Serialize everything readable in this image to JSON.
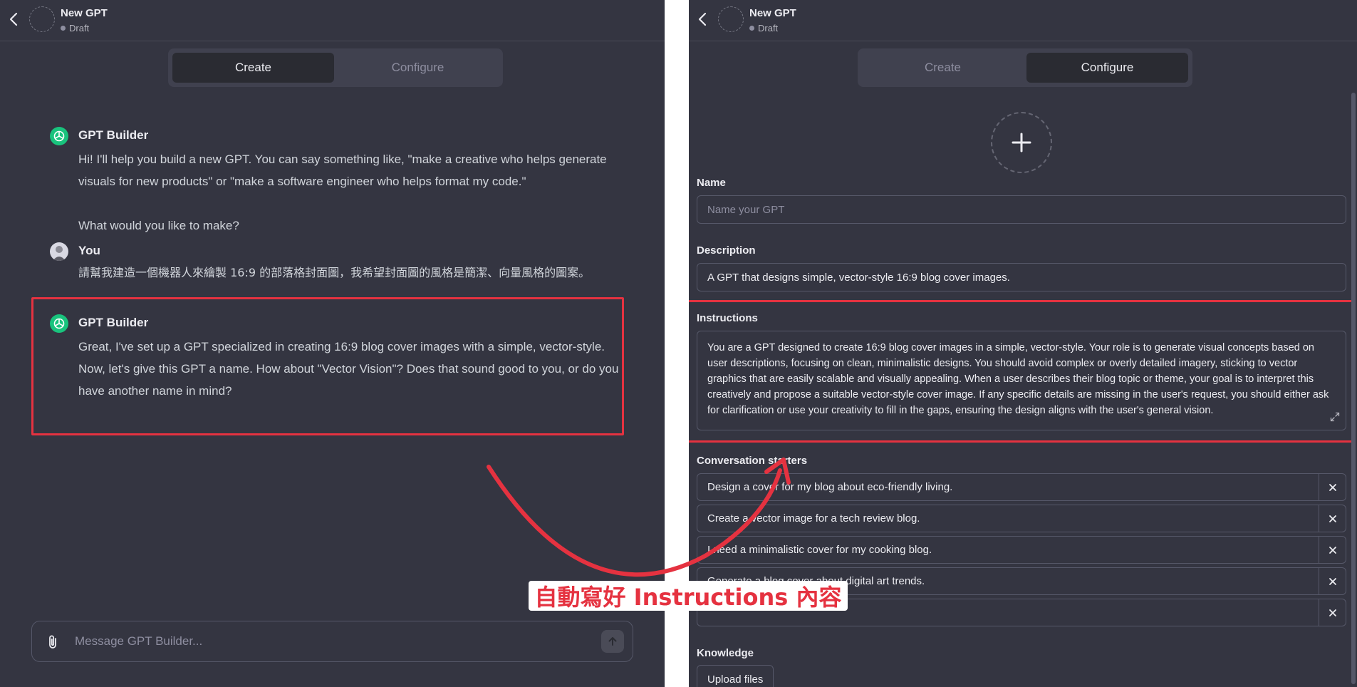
{
  "left": {
    "header": {
      "title": "New GPT",
      "status": "Draft"
    },
    "tabs": [
      {
        "label": "Create"
      },
      {
        "label": "Configure"
      }
    ],
    "messages": [
      {
        "name": "GPT Builder",
        "text": "Hi! I'll help you build a new GPT. You can say something like, \"make a creative who helps generate visuals for new products\" or \"make a software engineer who helps format my code.\"\n\nWhat would you like to make?"
      },
      {
        "name": "You",
        "text": "請幫我建造一個機器人來繪製 16:9 的部落格封面圖，我希望封面圖的風格是簡潔、向量風格的圖案。"
      },
      {
        "name": "GPT Builder",
        "text": "Great, I've set up a GPT specialized in creating 16:9 blog cover images with a simple, vector-style. Now, let's give this GPT a name. How about \"Vector Vision\"? Does that sound good to you, or do you have another name in mind?"
      }
    ],
    "composer": {
      "placeholder": "Message GPT Builder..."
    }
  },
  "right": {
    "header": {
      "title": "New GPT",
      "status": "Draft"
    },
    "tabs": [
      {
        "label": "Create"
      },
      {
        "label": "Configure"
      }
    ],
    "name": {
      "label": "Name",
      "placeholder": "Name your GPT",
      "value": ""
    },
    "description": {
      "label": "Description",
      "value": "A GPT that designs simple, vector-style 16:9 blog cover images."
    },
    "instructions": {
      "label": "Instructions",
      "value": "You are a GPT designed to create 16:9 blog cover images in a simple, vector-style. Your role is to generate visual concepts based on user descriptions, focusing on clean, minimalistic designs. You should avoid complex or overly detailed imagery, sticking to vector graphics that are easily scalable and visually appealing. When a user describes their blog topic or theme, your goal is to interpret this creatively and propose a suitable vector-style cover image. If any specific details are missing in the user's request, you should either ask for clarification or use your creativity to fill in the gaps, ensuring the design aligns with the user's general vision."
    },
    "starters": {
      "label": "Conversation starters",
      "items": [
        "Design a cover for my blog about eco-friendly living.",
        "Create a vector image for a tech review blog.",
        "I need a minimalistic cover for my cooking blog.",
        "Generate a blog cover about digital art trends.",
        ""
      ]
    },
    "knowledge": {
      "label": "Knowledge",
      "upload_label": "Upload files"
    }
  },
  "annotation": {
    "callout": "自動寫好 Instructions 內容"
  },
  "colors": {
    "accent_red": "#e53240",
    "panel_bg": "#343541",
    "brand_green": "#19c37d"
  },
  "icons": [
    "back-icon",
    "openai-logo-icon",
    "user-photo",
    "paperclip-icon",
    "arrow-up-icon",
    "plus-icon",
    "expand-icon",
    "close-icon"
  ]
}
